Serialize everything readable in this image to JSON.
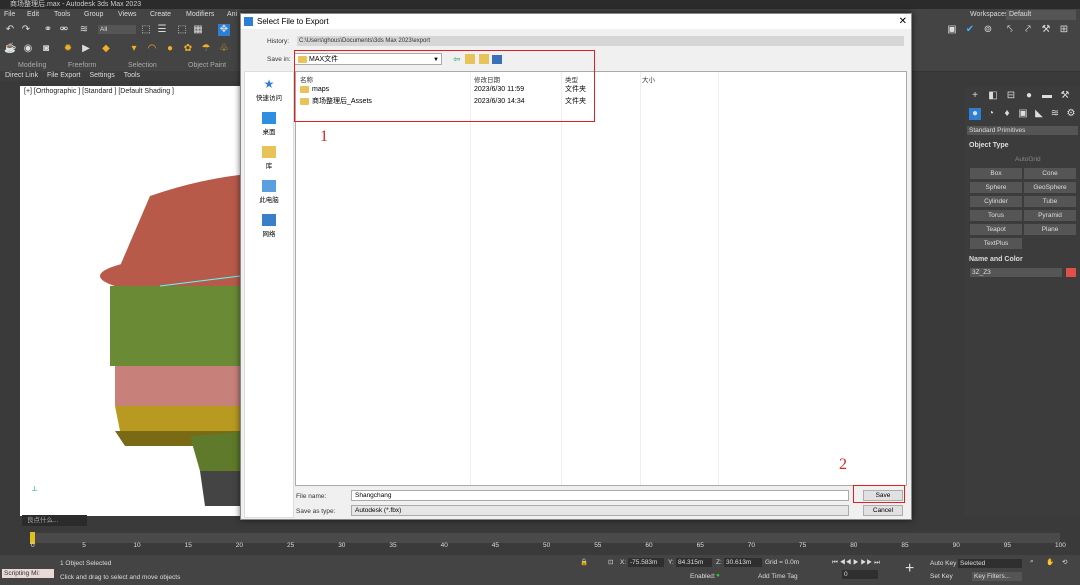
{
  "app": {
    "title": "商场整理后.max - Autodesk 3ds Max 2023"
  },
  "menu": [
    "File",
    "Edit",
    "Tools",
    "Group",
    "Views",
    "Create",
    "Modifiers",
    "Ani"
  ],
  "workspaces": {
    "label": "Workspaces:",
    "value": "Default"
  },
  "toolbar": {
    "selection_filter": "All",
    "groups": [
      "Modeling",
      "Freeform",
      "Selection",
      "Object Paint"
    ]
  },
  "ribbon": [
    "Direct Link",
    "File Export",
    "Settings",
    "Tools"
  ],
  "viewport": {
    "label": "[+] [Orthographic ] [Standard ] [Default Shading ]"
  },
  "command_panel": {
    "dropdown": "Standard Primitives",
    "object_type_header": "Object Type",
    "autogrid": "AutoGrid",
    "buttons": [
      "Box",
      "Cone",
      "Sphere",
      "GeoSphere",
      "Cylinder",
      "Tube",
      "Torus",
      "Pyramid",
      "Teapot",
      "Plane",
      "TextPlus"
    ],
    "name_color_header": "Name and Color",
    "name_value": "3Z_Z3",
    "color": "#e0504a"
  },
  "dialog": {
    "title": "Select File to Export",
    "history_label": "History:",
    "history_value": "C:\\Users\\ghous\\Documents\\3ds Max 2023\\export",
    "save_in_label": "Save in:",
    "save_in_value": "MAX文件",
    "places": [
      "快速访问",
      "桌面",
      "库",
      "此电脑",
      "网络"
    ],
    "columns": [
      "名称",
      "修改日期",
      "类型",
      "大小"
    ],
    "files": [
      {
        "name": "maps",
        "date": "2023/6/30 11:59",
        "type": "文件夹",
        "size": ""
      },
      {
        "name": "商场整理后_Assets",
        "date": "2023/6/30 14:34",
        "type": "文件夹",
        "size": ""
      }
    ],
    "file_name_label": "File name:",
    "file_name_value": "Shangchang",
    "save_as_type_label": "Save as type:",
    "save_as_type_value": "Autodesk (*.fbx)",
    "save_button": "Save",
    "cancel_button": "Cancel",
    "annotation_1": "1",
    "annotation_2": "2"
  },
  "timeline": {
    "ticks": [
      "0",
      "5",
      "10",
      "15",
      "20",
      "25",
      "30",
      "35",
      "40",
      "45",
      "50",
      "55",
      "60",
      "65",
      "70",
      "75",
      "80",
      "85",
      "90",
      "95",
      "100"
    ]
  },
  "status": {
    "selection": "1 Object Selected",
    "prompt": "Click and drag to select and move objects",
    "script": "Scripting Mi:",
    "x_label": "X:",
    "x": "-75.583m",
    "y_label": "Y:",
    "y": "84.315m",
    "z_label": "Z:",
    "z": "30.613m",
    "grid": "Grid = 0.0m",
    "enabled": "Enabled:",
    "add_time_tag": "Add Time Tag",
    "auto_key": "Auto Key",
    "selected": "Selected",
    "set_key": "Set Key",
    "key_filters": "Key Filters...",
    "frame": "0",
    "search_hint": "良点什么..."
  }
}
